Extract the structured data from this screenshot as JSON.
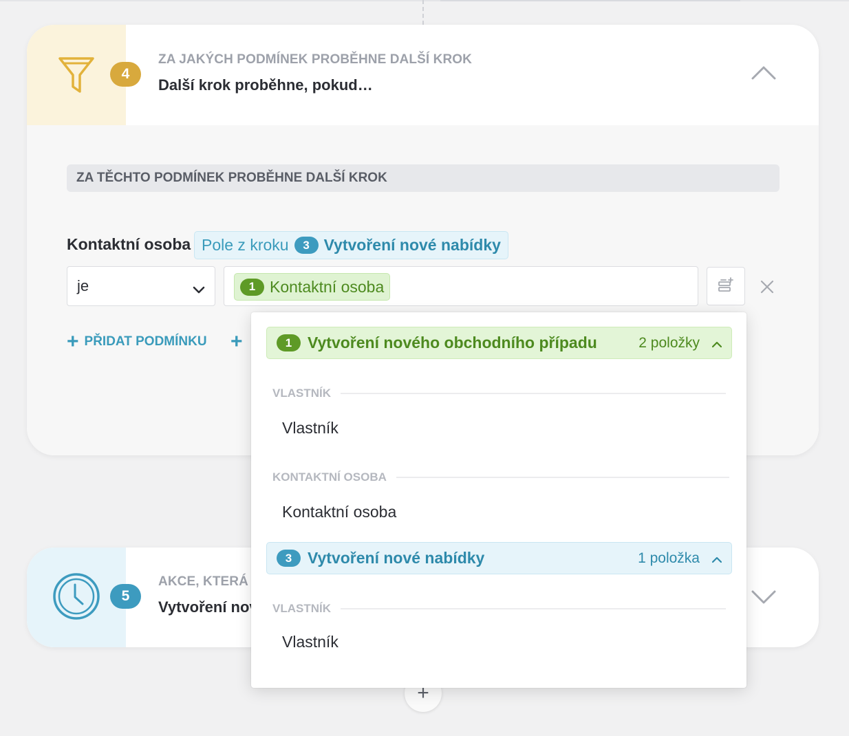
{
  "step4": {
    "badge": "4",
    "label": "Za jakých podmínek proběhne další krok",
    "title": "Další krok proběhne, pokud…",
    "icon": "filter-icon",
    "accent": "#e2b23b",
    "section_title": "Za těchto podmínek proběhne další krok",
    "condition": {
      "field_label": "Kontaktní osoba",
      "source_prefix": "Pole z kroku",
      "source_step": "3",
      "source_name": "Vytvoření nové nabídky",
      "operator": "je",
      "value_step": "1",
      "value_text": "Kontaktní osoba"
    },
    "add_condition_label": "Přidat podmínku"
  },
  "step5": {
    "badge": "5",
    "label": "Akce, která p",
    "title": "Vytvoření nov",
    "icon": "clock-icon",
    "accent": "#3d9bbf"
  },
  "dropdown": {
    "group1": {
      "step": "1",
      "title": "Vytvoření nového obchodního případu",
      "count": "2 položky",
      "sections": [
        {
          "label": "Vlastník",
          "item": "Vlastník"
        },
        {
          "label": "Kontaktní osoba",
          "item": "Kontaktní osoba"
        }
      ]
    },
    "group2": {
      "step": "3",
      "title": "Vytvoření nové nabídky",
      "count": "1 položka",
      "sections": [
        {
          "label": "Vlastník",
          "item": "Vlastník"
        }
      ]
    }
  },
  "add_step_label": "+"
}
